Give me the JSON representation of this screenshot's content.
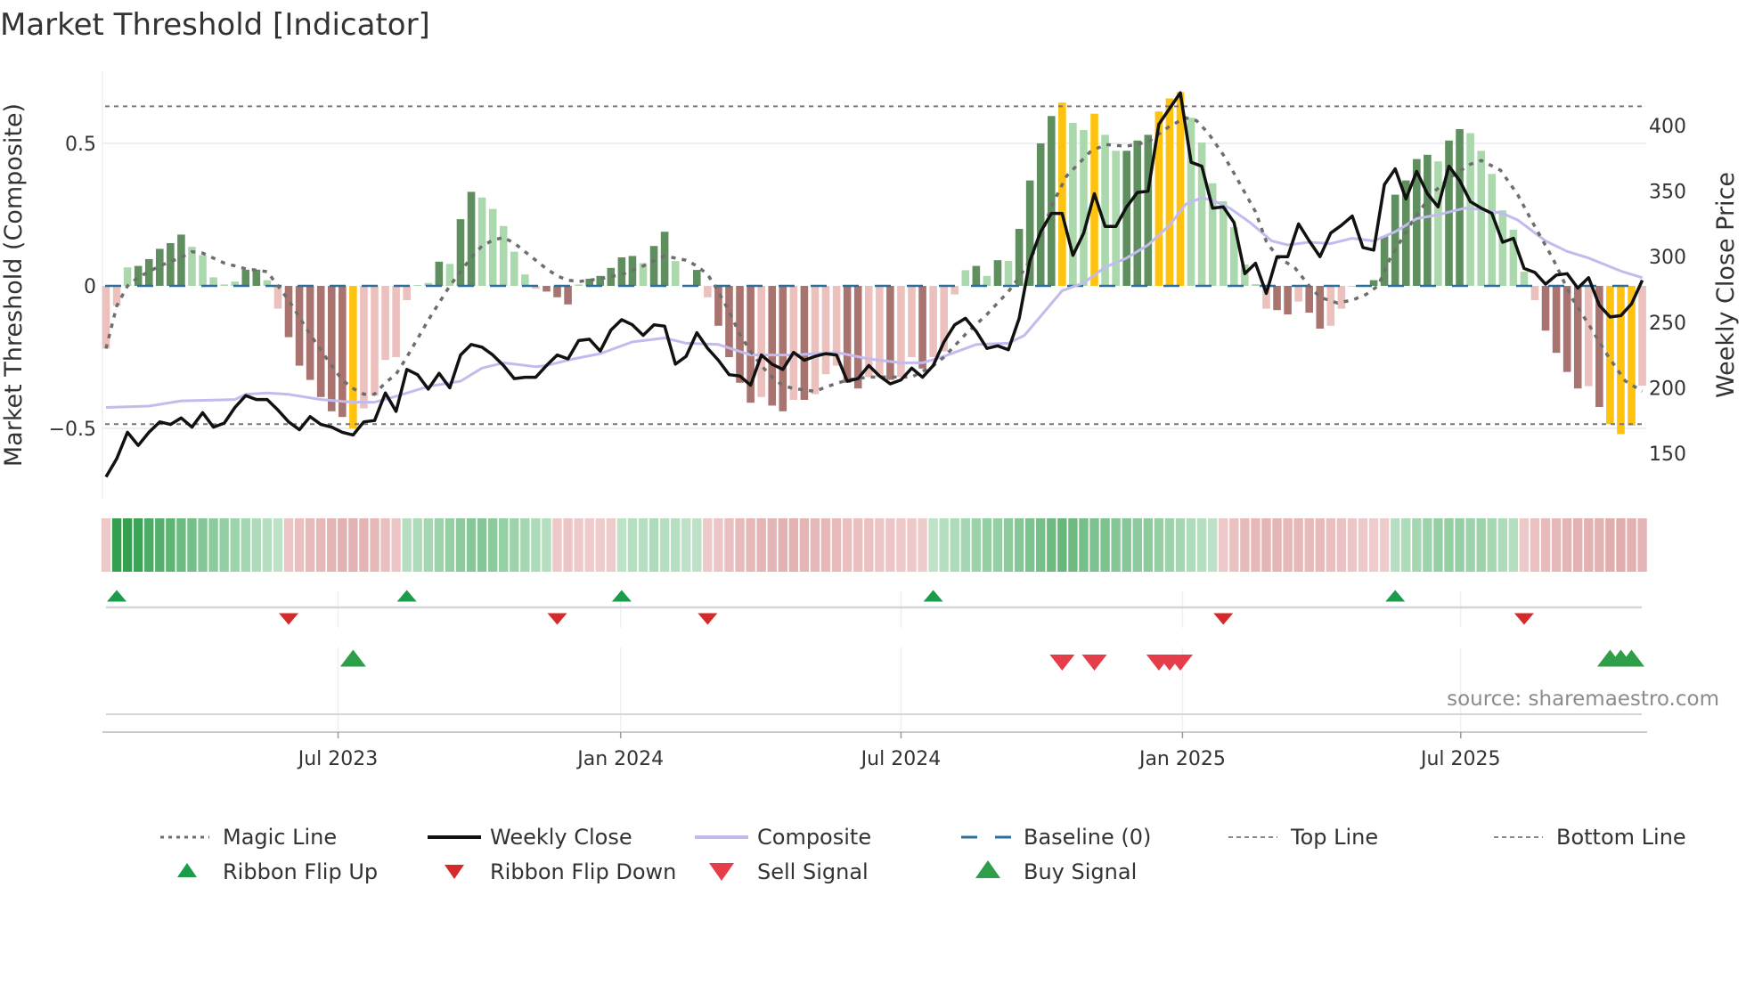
{
  "chart_data": {
    "type": "bar",
    "title": "Market Threshold [Indicator]",
    "ylabel_left": "Market Threshold (Composite)",
    "ylabel_right": "Weekly Close Price",
    "ylim_left": [
      -0.78,
      0.74
    ],
    "ylim_right": [
      128,
      432
    ],
    "left_ticks": [
      {
        "v": 0.5,
        "label": "0.5"
      },
      {
        "v": 0,
        "label": "0"
      },
      {
        "v": -0.5,
        "label": "−0.5"
      }
    ],
    "right_ticks": [
      {
        "v": 150,
        "label": "150"
      },
      {
        "v": 200,
        "label": "200"
      },
      {
        "v": 250,
        "label": "250"
      },
      {
        "v": 300,
        "label": "300"
      },
      {
        "v": 350,
        "label": "350"
      },
      {
        "v": 400,
        "label": "400"
      }
    ],
    "x_ticks": [
      {
        "week": 21.6,
        "label": "Jul 2023"
      },
      {
        "week": 47.9,
        "label": "Jan 2024"
      },
      {
        "week": 74,
        "label": "Jul 2024"
      },
      {
        "week": 100.2,
        "label": "Jan 2025"
      },
      {
        "week": 126.1,
        "label": "Jul 2025"
      }
    ],
    "top_line": 0.63,
    "bottom_line": -0.485,
    "baseline": 0,
    "weeks": 144,
    "composite_bars": [
      -0.22,
      -0.07,
      0.065,
      0.07,
      0.094,
      0.13,
      0.15,
      0.18,
      0.137,
      0.108,
      0.03,
      0.005,
      0.015,
      0.057,
      0.057,
      0.02,
      -0.08,
      -0.18,
      -0.28,
      -0.33,
      -0.39,
      -0.44,
      -0.46,
      -0.5,
      -0.43,
      -0.385,
      -0.26,
      -0.25,
      -0.05,
      0.003,
      0.01,
      0.085,
      0.077,
      0.234,
      0.33,
      0.31,
      0.27,
      0.21,
      0.12,
      0.04,
      -0.01,
      -0.02,
      -0.04,
      -0.065,
      0.005,
      0.025,
      0.035,
      0.063,
      0.1,
      0.105,
      0.08,
      0.14,
      0.19,
      0.087,
      0.003,
      0.056,
      -0.04,
      -0.14,
      -0.25,
      -0.34,
      -0.41,
      -0.39,
      -0.42,
      -0.44,
      -0.4,
      -0.4,
      -0.38,
      -0.31,
      -0.28,
      -0.34,
      -0.36,
      -0.32,
      -0.32,
      -0.33,
      -0.32,
      -0.25,
      -0.29,
      -0.25,
      -0.23,
      -0.03,
      0.055,
      0.07,
      0.035,
      0.09,
      0.088,
      0.2,
      0.37,
      0.5,
      0.596,
      0.643,
      0.572,
      0.547,
      0.604,
      0.53,
      0.474,
      0.474,
      0.51,
      0.53,
      0.612,
      0.658,
      0.68,
      0.59,
      0.503,
      0.36,
      0.297,
      0.206,
      0.075,
      0.006,
      -0.08,
      -0.085,
      -0.1,
      -0.055,
      -0.094,
      -0.15,
      -0.14,
      -0.08,
      -0.003,
      0.003,
      0.02,
      0.174,
      0.32,
      0.37,
      0.445,
      0.46,
      0.437,
      0.51,
      0.55,
      0.536,
      0.474,
      0.393,
      0.265,
      0.197,
      0.05,
      -0.05,
      -0.157,
      -0.235,
      -0.302,
      -0.36,
      -0.352,
      -0.425,
      -0.485,
      -0.52,
      -0.49,
      -0.35
    ],
    "bar_states": "rrgGGGGGgggggGGgrRRRRRRYrrrrrggGgGGgggggrRRRgGGGGGgGGggGrRRRRrRRrRrrrRRrrRrrRrrrgGgGgGGGGYggYggGGGYYYgggggggrRRrRRrrrgGGGGGGgGGggggggrRRRRrRYYYr",
    "bar_state_legend": {
      "G": "positive rising",
      "g": "positive fading",
      "R": "negative falling",
      "r": "negative fading",
      "Y": "extreme"
    },
    "weekly_close": [
      132,
      146,
      166,
      156,
      166,
      174,
      172,
      177,
      170,
      181,
      170,
      173,
      185,
      194,
      191,
      191,
      183,
      174,
      168,
      178,
      172,
      170,
      166,
      164,
      174,
      175,
      196,
      182,
      214,
      210,
      199,
      211,
      200,
      225,
      233,
      231,
      225,
      217,
      207,
      208,
      208,
      217,
      225,
      222,
      236,
      237,
      228,
      244,
      252,
      248,
      240,
      248,
      247,
      218,
      224,
      242,
      230,
      221,
      210,
      209,
      202,
      225,
      218,
      214,
      227,
      221,
      224,
      226,
      225,
      205,
      207,
      217,
      209,
      203,
      206,
      215,
      208,
      217,
      235,
      248,
      253,
      243,
      230,
      232,
      229,
      253,
      297,
      319,
      333,
      333,
      301,
      318,
      348,
      323,
      323,
      338,
      349,
      350,
      401,
      413,
      425,
      372,
      369,
      337,
      338,
      326,
      287,
      295,
      272,
      300,
      300,
      325,
      312,
      300,
      318,
      324,
      331,
      307,
      305,
      355,
      367,
      344,
      365,
      348,
      338,
      369,
      358,
      342,
      337,
      333,
      311,
      314,
      291,
      288,
      279,
      286,
      287,
      276,
      284,
      263,
      254,
      255,
      264,
      282
    ],
    "magic_line": [
      [
        0,
        -0.22
      ],
      [
        1,
        -0.07
      ],
      [
        2,
        0.0
      ],
      [
        3,
        0.03
      ],
      [
        5,
        0.07
      ],
      [
        7,
        0.1
      ],
      [
        8,
        0.12
      ],
      [
        9,
        0.115
      ],
      [
        11,
        0.08
      ],
      [
        13,
        0.06
      ],
      [
        15,
        0.05
      ],
      [
        16,
        0.0
      ],
      [
        17,
        -0.05
      ],
      [
        19,
        -0.17
      ],
      [
        21,
        -0.28
      ],
      [
        22,
        -0.33
      ],
      [
        23,
        -0.36
      ],
      [
        24,
        -0.38
      ],
      [
        25,
        -0.38
      ],
      [
        26,
        -0.34
      ],
      [
        27,
        -0.31
      ],
      [
        28,
        -0.25
      ],
      [
        30,
        -0.12
      ],
      [
        32,
        0.0
      ],
      [
        33,
        0.05
      ],
      [
        34,
        0.1
      ],
      [
        35,
        0.14
      ],
      [
        36,
        0.16
      ],
      [
        37,
        0.17
      ],
      [
        38,
        0.15
      ],
      [
        39,
        0.12
      ],
      [
        40,
        0.09
      ],
      [
        41,
        0.06
      ],
      [
        42,
        0.035
      ],
      [
        43,
        0.02
      ],
      [
        44,
        0.015
      ],
      [
        46,
        0.025
      ],
      [
        48,
        0.04
      ],
      [
        50,
        0.07
      ],
      [
        52,
        0.105
      ],
      [
        54,
        0.09
      ],
      [
        55,
        0.07
      ],
      [
        56,
        0.04
      ],
      [
        57,
        -0.02
      ],
      [
        58,
        -0.09
      ],
      [
        59,
        -0.17
      ],
      [
        60,
        -0.23
      ],
      [
        61,
        -0.28
      ],
      [
        62,
        -0.32
      ],
      [
        63,
        -0.35
      ],
      [
        64,
        -0.36
      ],
      [
        66,
        -0.37
      ],
      [
        67,
        -0.355
      ],
      [
        69,
        -0.33
      ],
      [
        71,
        -0.32
      ],
      [
        75,
        -0.32
      ],
      [
        77,
        -0.28
      ],
      [
        78,
        -0.25
      ],
      [
        79,
        -0.21
      ],
      [
        80,
        -0.17
      ],
      [
        82,
        -0.1
      ],
      [
        84,
        -0.02
      ],
      [
        85,
        0.03
      ],
      [
        86,
        0.09
      ],
      [
        87,
        0.17
      ],
      [
        88,
        0.28
      ],
      [
        89.4,
        0.385
      ],
      [
        91.6,
        0.47
      ],
      [
        93,
        0.496
      ],
      [
        95,
        0.49
      ],
      [
        97,
        0.505
      ],
      [
        99,
        0.56
      ],
      [
        100.5,
        0.59
      ],
      [
        101.5,
        0.58
      ],
      [
        102.6,
        0.536
      ],
      [
        104,
        0.46
      ],
      [
        105,
        0.395
      ],
      [
        107,
        0.26
      ],
      [
        108,
        0.156
      ],
      [
        109,
        0.104
      ],
      [
        110.7,
        0.062
      ],
      [
        112,
        0.0
      ],
      [
        113,
        -0.04
      ],
      [
        114.6,
        -0.06
      ],
      [
        116,
        -0.05
      ],
      [
        117.3,
        -0.03
      ],
      [
        118.4,
        0.0
      ],
      [
        119.5,
        0.094
      ],
      [
        121.5,
        0.22
      ],
      [
        123.4,
        0.323
      ],
      [
        125.3,
        0.385
      ],
      [
        127,
        0.427
      ],
      [
        128,
        0.44
      ],
      [
        129.8,
        0.406
      ],
      [
        131.4,
        0.32
      ],
      [
        133,
        0.208
      ],
      [
        134.7,
        0.094
      ],
      [
        136.4,
        -0.04
      ],
      [
        138,
        -0.135
      ],
      [
        139.7,
        -0.24
      ],
      [
        141.4,
        -0.333
      ],
      [
        143,
        -0.37
      ]
    ],
    "composite_line": [
      [
        0,
        185
      ],
      [
        4,
        186
      ],
      [
        7,
        190
      ],
      [
        12,
        191
      ],
      [
        13,
        195
      ],
      [
        15,
        196
      ],
      [
        17,
        195
      ],
      [
        20,
        191
      ],
      [
        23,
        189
      ],
      [
        25,
        189
      ],
      [
        27,
        193.5
      ],
      [
        30,
        201
      ],
      [
        33,
        205
      ],
      [
        35,
        215
      ],
      [
        37,
        219
      ],
      [
        40,
        216
      ],
      [
        41,
        217
      ],
      [
        43.5,
        222
      ],
      [
        46,
        226
      ],
      [
        49,
        235
      ],
      [
        52,
        238
      ],
      [
        54,
        234
      ],
      [
        57,
        233
      ],
      [
        60,
        225
      ],
      [
        64,
        225
      ],
      [
        68,
        227
      ],
      [
        71,
        222
      ],
      [
        74,
        219
      ],
      [
        76,
        219
      ],
      [
        78,
        224
      ],
      [
        81,
        233
      ],
      [
        84,
        234
      ],
      [
        85.5,
        240
      ],
      [
        89,
        274
      ],
      [
        91,
        280
      ],
      [
        93,
        292
      ],
      [
        95,
        299
      ],
      [
        97,
        309
      ],
      [
        99,
        324
      ],
      [
        100.5,
        340
      ],
      [
        102,
        345
      ],
      [
        103,
        343
      ],
      [
        104.6,
        337
      ],
      [
        106.5,
        326
      ],
      [
        108.5,
        312
      ],
      [
        110,
        309
      ],
      [
        112,
        311
      ],
      [
        114,
        310
      ],
      [
        116,
        314
      ],
      [
        118,
        312
      ],
      [
        120,
        319
      ],
      [
        122,
        329
      ],
      [
        124,
        332
      ],
      [
        126.5,
        337
      ],
      [
        128,
        336
      ],
      [
        130,
        333
      ],
      [
        131.4,
        328
      ],
      [
        134,
        312
      ],
      [
        136,
        304
      ],
      [
        138,
        299
      ],
      [
        141,
        289
      ],
      [
        143,
        284
      ]
    ],
    "ribbon": [
      -0.25,
      1.0,
      1.0,
      0.95,
      0.85,
      0.8,
      0.75,
      0.65,
      0.6,
      0.5,
      0.45,
      0.4,
      0.35,
      0.3,
      0.25,
      0.2,
      0.15,
      -0.3,
      -0.4,
      -0.45,
      -0.5,
      -0.55,
      -0.6,
      -0.6,
      -0.55,
      -0.5,
      -0.4,
      -0.3,
      0.2,
      0.25,
      0.3,
      0.35,
      0.4,
      0.45,
      0.5,
      0.5,
      0.45,
      0.4,
      0.35,
      0.3,
      0.25,
      0.2,
      -0.25,
      -0.3,
      -0.25,
      -0.2,
      -0.2,
      -0.2,
      0.15,
      0.2,
      0.2,
      0.25,
      0.2,
      0.2,
      0.15,
      0.15,
      -0.25,
      -0.3,
      -0.4,
      -0.45,
      -0.5,
      -0.55,
      -0.55,
      -0.6,
      -0.6,
      -0.55,
      -0.5,
      -0.5,
      -0.45,
      -0.4,
      -0.4,
      -0.35,
      -0.3,
      -0.3,
      -0.25,
      -0.25,
      -0.2,
      0.15,
      0.2,
      0.25,
      0.3,
      0.35,
      0.4,
      0.4,
      0.45,
      0.5,
      0.55,
      0.6,
      0.65,
      0.7,
      0.65,
      0.6,
      0.55,
      0.55,
      0.5,
      0.5,
      0.45,
      0.45,
      0.4,
      0.35,
      0.3,
      0.25,
      0.2,
      0.15,
      -0.25,
      -0.35,
      -0.45,
      -0.5,
      -0.55,
      -0.55,
      -0.5,
      -0.5,
      -0.45,
      -0.45,
      -0.4,
      -0.35,
      -0.3,
      -0.25,
      -0.2,
      -0.2,
      0.2,
      0.25,
      0.3,
      0.35,
      0.4,
      0.4,
      0.4,
      0.35,
      0.35,
      0.3,
      0.25,
      0.2,
      -0.25,
      -0.35,
      -0.45,
      -0.5,
      -0.55,
      -0.6,
      -0.6,
      -0.6,
      -0.65,
      -0.65,
      -0.6,
      -0.55
    ],
    "ribbon_flip_up_weeks": [
      1,
      28,
      48,
      77,
      120
    ],
    "ribbon_flip_down_weeks": [
      17,
      42,
      56,
      104,
      132
    ],
    "buy_signal_weeks": [
      23,
      140,
      141,
      142
    ],
    "sell_signal_weeks": [
      89,
      92,
      98,
      99,
      100
    ],
    "legend": [
      {
        "key": "magic",
        "label": "Magic Line"
      },
      {
        "key": "close",
        "label": "Weekly Close"
      },
      {
        "key": "composite",
        "label": "Composite"
      },
      {
        "key": "baseline",
        "label": "Baseline (0)"
      },
      {
        "key": "top",
        "label": "Top Line"
      },
      {
        "key": "bottom",
        "label": "Bottom Line"
      },
      {
        "key": "flipup",
        "label": "Ribbon Flip Up"
      },
      {
        "key": "flipdown",
        "label": "Ribbon Flip Down"
      },
      {
        "key": "sell",
        "label": "Sell Signal"
      },
      {
        "key": "buy",
        "label": "Buy Signal"
      }
    ],
    "legend_placement": "bottom",
    "grid": true
  },
  "source": "source: sharemaestro.com",
  "colors": {
    "dark_green": "#5f8f5f",
    "light_green": "#acd8ad",
    "dark_red": "#a9746f",
    "pink": "#ecc0bd",
    "yellow": "#ffc20e",
    "magic": "#6e6e6e",
    "close": "#111111",
    "composite": "#c3bbee",
    "baseline": "#2a6f9b",
    "flip_up": "#1a9c4a",
    "flip_down": "#d42a2a",
    "sell": "#e63d4b",
    "buy": "#2f9e48"
  }
}
